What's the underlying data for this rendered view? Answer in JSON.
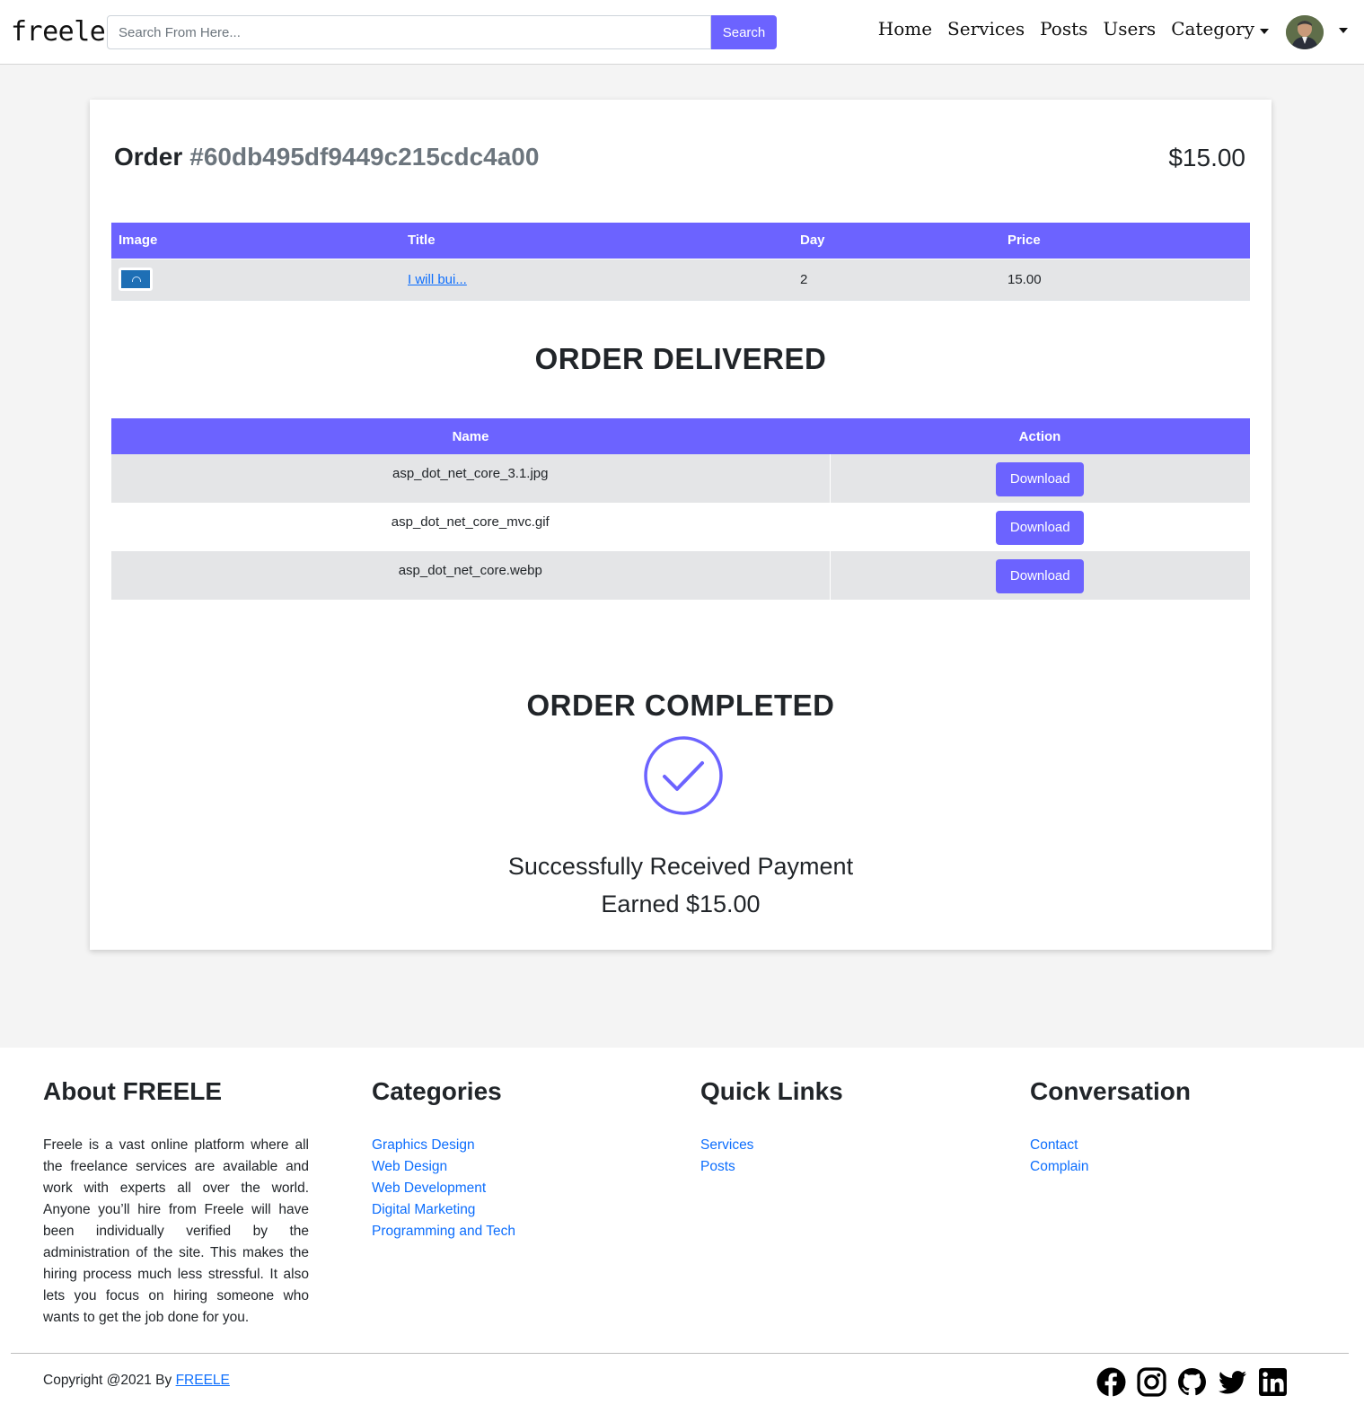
{
  "nav": {
    "brand": "freele",
    "search_placeholder": "Search From Here...",
    "search_button": "Search",
    "links": [
      "Home",
      "Services",
      "Posts",
      "Users",
      "Category"
    ]
  },
  "order": {
    "label": "Order",
    "id": "#60db495df9449c215cdc4a00",
    "total": "$15.00",
    "items_table": {
      "headers": [
        "Image",
        "Title",
        "Day",
        "Price"
      ],
      "rows": [
        {
          "title": "I will bui...",
          "day": "2",
          "price": "15.00"
        }
      ]
    },
    "delivered_heading": "ORDER DELIVERED",
    "files_table": {
      "headers": [
        "Name",
        "Action"
      ],
      "rows": [
        {
          "name": "asp_dot_net_core_3.1.jpg",
          "action": "Download"
        },
        {
          "name": "asp_dot_net_core_mvc.gif",
          "action": "Download"
        },
        {
          "name": "asp_dot_net_core.webp",
          "action": "Download"
        }
      ]
    },
    "completed_heading": "ORDER COMPLETED",
    "payment_message": "Successfully Received Payment",
    "earned": "Earned $15.00"
  },
  "footer": {
    "about_heading": "About FREELE",
    "about_text": "Freele is a vast online platform where all the freelance services are available and work with experts all over the world. Anyone you’ll hire from Freele will have been individually verified by the administration of the site. This makes the hiring process much less stressful. It also lets you focus on hiring someone who wants to get the job done for you.",
    "categories_heading": "Categories",
    "categories": [
      "Graphics Design",
      "Web Design",
      "Web Development",
      "Digital Marketing",
      "Programming and Tech"
    ],
    "quick_links_heading": "Quick Links",
    "quick_links": [
      "Services",
      "Posts"
    ],
    "conversation_heading": "Conversation",
    "conversation_links": [
      "Contact",
      "Complain"
    ],
    "copyright_prefix": "Copyright @2021 By",
    "copyright_link": "FREELE",
    "social_icons": [
      "facebook-icon",
      "instagram-icon",
      "github-icon",
      "twitter-icon",
      "linkedin-icon"
    ]
  },
  "colors": {
    "accent": "#6c63ff",
    "link": "#0d6efd",
    "page_bg": "#f4f4f4"
  }
}
